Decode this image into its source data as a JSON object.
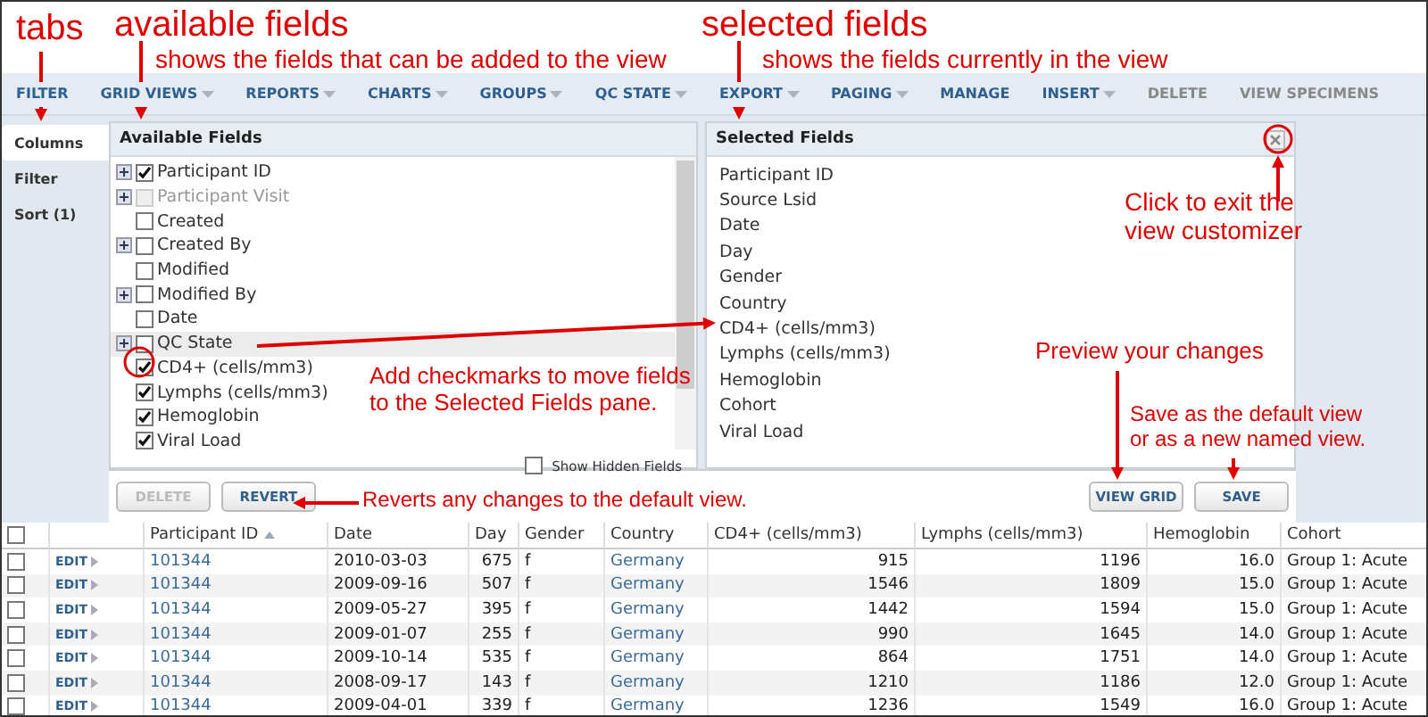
{
  "annotations": [
    {
      "text": "tabs",
      "kind": "title"
    },
    {
      "text": "available fields",
      "kind": "title"
    },
    {
      "text": "shows the fields that can be added to the view",
      "kind": "note"
    },
    {
      "text": "selected fields",
      "kind": "title"
    },
    {
      "text": "shows the fields currently in the view",
      "kind": "note"
    },
    {
      "text": "Click to exit the\nview customizer",
      "kind": "note"
    },
    {
      "text": "Add checkmarks to move fields\nto the Selected Fields pane.",
      "kind": "note"
    },
    {
      "text": "Preview your changes",
      "kind": "note"
    },
    {
      "text": "Save as the default view\nor as a new named view.",
      "kind": "small"
    },
    {
      "text": "Reverts any changes to the default view.",
      "kind": "small"
    }
  ],
  "toolbar": [
    {
      "label": "FILTER",
      "dropdown": false,
      "disabled": false
    },
    {
      "label": "GRID VIEWS",
      "dropdown": true,
      "disabled": false
    },
    {
      "label": "REPORTS",
      "dropdown": true,
      "disabled": false
    },
    {
      "label": "CHARTS",
      "dropdown": true,
      "disabled": false
    },
    {
      "label": "GROUPS",
      "dropdown": true,
      "disabled": false
    },
    {
      "label": "QC STATE",
      "dropdown": true,
      "disabled": false
    },
    {
      "label": "EXPORT",
      "dropdown": true,
      "disabled": false
    },
    {
      "label": "PAGING",
      "dropdown": true,
      "disabled": false
    },
    {
      "label": "MANAGE",
      "dropdown": false,
      "disabled": false
    },
    {
      "label": "INSERT",
      "dropdown": true,
      "disabled": false
    },
    {
      "label": "DELETE",
      "dropdown": false,
      "disabled": true
    },
    {
      "label": "VIEW SPECIMENS",
      "dropdown": false,
      "disabled": true
    }
  ],
  "tabs": [
    {
      "label": "Columns",
      "selected": true
    },
    {
      "label": "Filter",
      "selected": false
    },
    {
      "label": "Sort (1)",
      "selected": false
    }
  ],
  "available_fields": {
    "title": "Available Fields",
    "items": [
      {
        "label": "Participant ID",
        "expandable": true,
        "checked": true,
        "disabled": false,
        "highlighted": false
      },
      {
        "label": "Participant Visit",
        "expandable": true,
        "checked": false,
        "disabled": true,
        "highlighted": false
      },
      {
        "label": "Created",
        "expandable": false,
        "checked": false,
        "disabled": false,
        "highlighted": false
      },
      {
        "label": "Created By",
        "expandable": true,
        "checked": false,
        "disabled": false,
        "highlighted": false
      },
      {
        "label": "Modified",
        "expandable": false,
        "checked": false,
        "disabled": false,
        "highlighted": false
      },
      {
        "label": "Modified By",
        "expandable": true,
        "checked": false,
        "disabled": false,
        "highlighted": false
      },
      {
        "label": "Date",
        "expandable": false,
        "checked": false,
        "disabled": false,
        "highlighted": false
      },
      {
        "label": "QC State",
        "expandable": true,
        "checked": false,
        "disabled": false,
        "highlighted": true
      },
      {
        "label": "CD4+ (cells/mm3)",
        "expandable": false,
        "checked": true,
        "disabled": false,
        "highlighted": false
      },
      {
        "label": "Lymphs (cells/mm3)",
        "expandable": false,
        "checked": true,
        "disabled": false,
        "highlighted": false
      },
      {
        "label": "Hemoglobin",
        "expandable": false,
        "checked": true,
        "disabled": false,
        "highlighted": false
      },
      {
        "label": "Viral Load",
        "expandable": false,
        "checked": true,
        "disabled": false,
        "highlighted": false
      }
    ],
    "show_hidden": {
      "label": "Show Hidden Fields",
      "checked": false
    }
  },
  "selected_fields": {
    "title": "Selected Fields",
    "items": [
      "Participant ID",
      "Source Lsid",
      "Date",
      "Day",
      "Gender",
      "Country",
      "CD4+ (cells/mm3)",
      "Lymphs (cells/mm3)",
      "Hemoglobin",
      "Cohort",
      "Viral Load"
    ]
  },
  "left_buttons": [
    {
      "label": "DELETE",
      "disabled": true
    },
    {
      "label": "REVERT",
      "disabled": false
    }
  ],
  "right_buttons": [
    {
      "label": "VIEW GRID",
      "disabled": false
    },
    {
      "label": "SAVE",
      "disabled": false
    }
  ],
  "grid": {
    "select_all": {
      "checked": false
    },
    "columns": [
      {
        "label": "Participant ID",
        "kind": "link",
        "sorted": true
      },
      {
        "label": "Date",
        "kind": "text",
        "sorted": false
      },
      {
        "label": "Day",
        "kind": "number",
        "sorted": false
      },
      {
        "label": "Gender",
        "kind": "text",
        "sorted": false
      },
      {
        "label": "Country",
        "kind": "link",
        "sorted": false
      },
      {
        "label": "CD4+ (cells/mm3)",
        "kind": "number",
        "sorted": false
      },
      {
        "label": "Lymphs (cells/mm3)",
        "kind": "number",
        "sorted": false
      },
      {
        "label": "Hemoglobin",
        "kind": "number",
        "sorted": false
      },
      {
        "label": "Cohort",
        "kind": "text",
        "sorted": false
      }
    ],
    "rows": [
      {
        "checked": false,
        "edit": "EDIT",
        "cells": [
          "101344",
          "2010-03-03",
          "675",
          "f",
          "Germany",
          "915",
          "1196",
          "16.0",
          "Group 1: Acute"
        ]
      },
      {
        "checked": false,
        "edit": "EDIT",
        "cells": [
          "101344",
          "2009-09-16",
          "507",
          "f",
          "Germany",
          "1546",
          "1809",
          "15.0",
          "Group 1: Acute"
        ]
      },
      {
        "checked": false,
        "edit": "EDIT",
        "cells": [
          "101344",
          "2009-05-27",
          "395",
          "f",
          "Germany",
          "1442",
          "1594",
          "15.0",
          "Group 1: Acute"
        ]
      },
      {
        "checked": false,
        "edit": "EDIT",
        "cells": [
          "101344",
          "2009-01-07",
          "255",
          "f",
          "Germany",
          "990",
          "1645",
          "14.0",
          "Group 1: Acute"
        ]
      },
      {
        "checked": false,
        "edit": "EDIT",
        "cells": [
          "101344",
          "2009-10-14",
          "535",
          "f",
          "Germany",
          "864",
          "1751",
          "14.0",
          "Group 1: Acute"
        ]
      },
      {
        "checked": false,
        "edit": "EDIT",
        "cells": [
          "101344",
          "2008-09-17",
          "143",
          "f",
          "Germany",
          "1210",
          "1186",
          "12.0",
          "Group 1: Acute"
        ]
      },
      {
        "checked": false,
        "edit": "EDIT",
        "cells": [
          "101344",
          "2009-04-01",
          "339",
          "f",
          "Germany",
          "1236",
          "1549",
          "16.0",
          "Group 1: Acute"
        ]
      }
    ]
  }
}
